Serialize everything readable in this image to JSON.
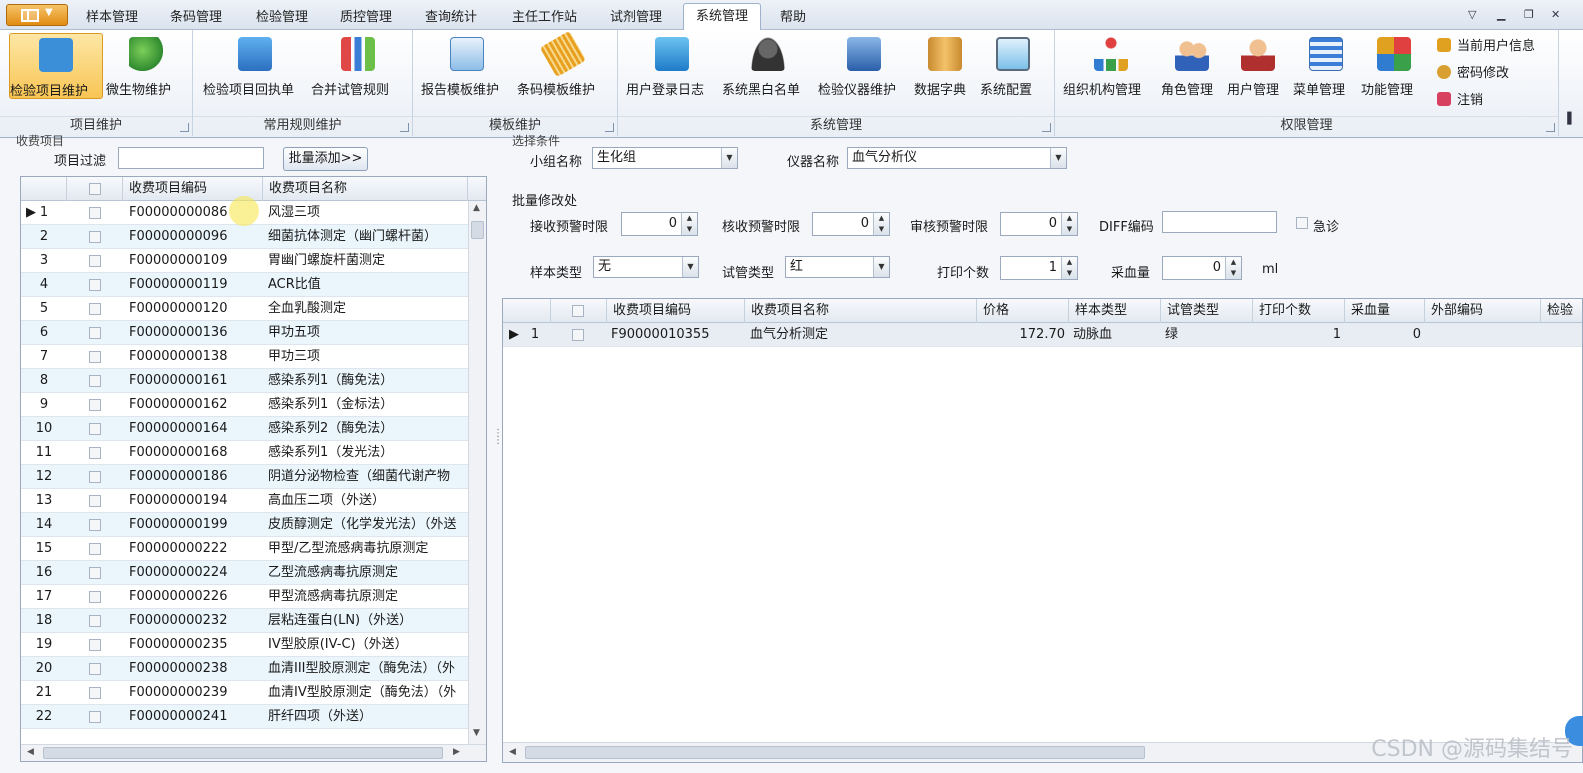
{
  "menubar": {
    "tabs": [
      "样本管理",
      "条码管理",
      "检验管理",
      "质控管理",
      "查询统计",
      "主任工作站",
      "试剂管理",
      "系统管理",
      "帮助"
    ],
    "active_tab": "系统管理"
  },
  "ribbon": {
    "groups": [
      {
        "label": "项目维护",
        "buttons": [
          "检验项目维护",
          "微生物维护"
        ]
      },
      {
        "label": "常用规则维护",
        "buttons": [
          "检验项目回执单",
          "合并试管规则"
        ]
      },
      {
        "label": "模板维护",
        "buttons": [
          "报告模板维护",
          "条码模板维护"
        ]
      },
      {
        "label": "系统管理",
        "buttons": [
          "用户登录日志",
          "系统黑白名单",
          "检验仪器维护",
          "数据字典",
          "系统配置"
        ]
      },
      {
        "label": "权限管理",
        "buttons": [
          "组织机构管理",
          "角色管理",
          "用户管理",
          "菜单管理",
          "功能管理"
        ],
        "small": [
          "当前用户信息",
          "密码修改",
          "注销"
        ]
      }
    ]
  },
  "left": {
    "section_title": "收费项目",
    "filter_label": "项目过滤",
    "filter_value": "",
    "batch_add": "批量添加>>",
    "columns": [
      "收费项目编码",
      "收费项目名称"
    ],
    "rows": [
      {
        "n": "1",
        "code": "F00000000086",
        "name": "风湿三项"
      },
      {
        "n": "2",
        "code": "F00000000096",
        "name": "细菌抗体测定（幽门螺杆菌）"
      },
      {
        "n": "3",
        "code": "F00000000109",
        "name": "胃幽门螺旋杆菌测定"
      },
      {
        "n": "4",
        "code": "F00000000119",
        "name": "ACR比值"
      },
      {
        "n": "5",
        "code": "F00000000120",
        "name": "全血乳酸测定"
      },
      {
        "n": "6",
        "code": "F00000000136",
        "name": "甲功五项"
      },
      {
        "n": "7",
        "code": "F00000000138",
        "name": "甲功三项"
      },
      {
        "n": "8",
        "code": "F00000000161",
        "name": "感染系列1（酶免法）"
      },
      {
        "n": "9",
        "code": "F00000000162",
        "name": "感染系列1（金标法）"
      },
      {
        "n": "10",
        "code": "F00000000164",
        "name": "感染系列2（酶免法）"
      },
      {
        "n": "11",
        "code": "F00000000168",
        "name": "感染系列1（发光法）"
      },
      {
        "n": "12",
        "code": "F00000000186",
        "name": "阴道分泌物检查（细菌代谢产物"
      },
      {
        "n": "13",
        "code": "F00000000194",
        "name": "高血压二项（外送）"
      },
      {
        "n": "14",
        "code": "F00000000199",
        "name": "皮质醇测定（化学发光法）（外送"
      },
      {
        "n": "15",
        "code": "F00000000222",
        "name": "甲型/乙型流感病毒抗原测定"
      },
      {
        "n": "16",
        "code": "F00000000224",
        "name": "乙型流感病毒抗原测定"
      },
      {
        "n": "17",
        "code": "F00000000226",
        "name": "甲型流感病毒抗原测定"
      },
      {
        "n": "18",
        "code": "F00000000232",
        "name": "层粘连蛋白(LN)（外送）"
      },
      {
        "n": "19",
        "code": "F00000000235",
        "name": "IV型胶原(IV-C)（外送）"
      },
      {
        "n": "20",
        "code": "F00000000238",
        "name": "血清III型胶原测定（酶免法）（外"
      },
      {
        "n": "21",
        "code": "F00000000239",
        "name": "血清IV型胶原测定（酶免法）（外"
      },
      {
        "n": "22",
        "code": "F00000000241",
        "name": "肝纤四项（外送）"
      }
    ]
  },
  "right": {
    "filter_title": "选择条件",
    "group_label": "小组名称",
    "group_value": "生化组",
    "instrument_label": "仪器名称",
    "instrument_value": "血气分析仪",
    "batch_title": "批量修改处",
    "recv_label": "接收预警时限",
    "recv_value": "0",
    "check_label": "核收预警时限",
    "check_value": "0",
    "audit_label": "审核预警时限",
    "audit_value": "0",
    "diff_label": "DIFF编码",
    "diff_value": "",
    "urgent_label": "急诊",
    "sample_label": "样本类型",
    "sample_value": "无",
    "tube_label": "试管类型",
    "tube_value": "红",
    "print_label": "打印个数",
    "print_value": "1",
    "blood_label": "采血量",
    "blood_value": "0",
    "blood_unit": "ml",
    "columns": [
      "收费项目编码",
      "收费项目名称",
      "价格",
      "样本类型",
      "试管类型",
      "打印个数",
      "采血量",
      "外部编码",
      "检验"
    ],
    "rows": [
      {
        "n": "1",
        "code": "F90000010355",
        "name": "血气分析测定",
        "price": "172.70",
        "sample": "动脉血",
        "tube": "绿",
        "print": "1",
        "blood": "0",
        "ext": ""
      }
    ]
  },
  "watermark": "CSDN @源码集结号"
}
